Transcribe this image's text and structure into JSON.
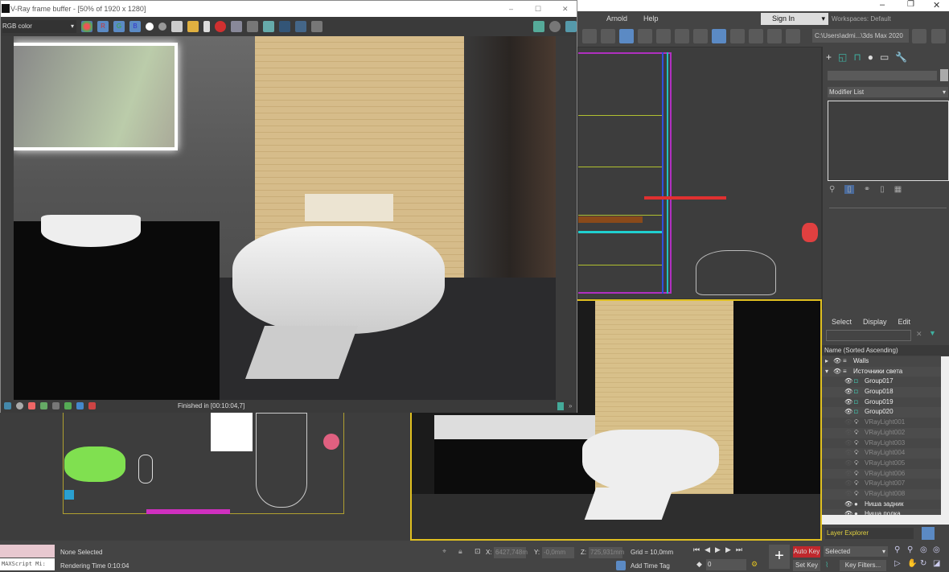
{
  "max": {
    "menu": [
      "Arnold",
      "Help"
    ],
    "sign_in": "Sign In",
    "workspaces_label": "Workspaces:",
    "workspace": "Default",
    "project_path": "C:\\Users\\admi...\\3ds Max 2020"
  },
  "vfb": {
    "title": "V-Ray frame buffer - [50% of 1920 x 1280]",
    "channel": "RGB color",
    "channel_buttons": [
      "R",
      "G",
      "B"
    ],
    "status": "Finished in [00:10:04,7]"
  },
  "command_panel": {
    "modifier_list": "Modifier List"
  },
  "scene_explorer": {
    "menu": [
      "Select",
      "Display",
      "Edit"
    ],
    "search_value": "",
    "column_header": "Name (Sorted Ascending)",
    "rows": [
      {
        "name": "Walls",
        "level": 0,
        "expand": "collapsed",
        "visible": true
      },
      {
        "name": "Источники света",
        "level": 0,
        "expand": "expanded",
        "visible": true
      },
      {
        "name": "Group017",
        "level": 1,
        "visible": true,
        "icon": "group"
      },
      {
        "name": "Group018",
        "level": 1,
        "visible": true,
        "icon": "group"
      },
      {
        "name": "Group019",
        "level": 1,
        "visible": true,
        "icon": "group"
      },
      {
        "name": "Group020",
        "level": 1,
        "visible": true,
        "icon": "group"
      },
      {
        "name": "VRayLight001",
        "level": 1,
        "visible": false,
        "icon": "light"
      },
      {
        "name": "VRayLight002",
        "level": 1,
        "visible": false,
        "icon": "light"
      },
      {
        "name": "VRayLight003",
        "level": 1,
        "visible": false,
        "icon": "light"
      },
      {
        "name": "VRayLight004",
        "level": 1,
        "visible": false,
        "icon": "light"
      },
      {
        "name": "VRayLight005",
        "level": 1,
        "visible": false,
        "icon": "light"
      },
      {
        "name": "VRayLight006",
        "level": 1,
        "visible": false,
        "icon": "light"
      },
      {
        "name": "VRayLight007",
        "level": 1,
        "visible": false,
        "icon": "light"
      },
      {
        "name": "VRayLight008",
        "level": 1,
        "visible": false,
        "icon": "light"
      },
      {
        "name": "Ниша задник",
        "level": 1,
        "visible": true,
        "icon": "object"
      },
      {
        "name": "Ниша полка",
        "level": 1,
        "visible": true,
        "icon": "object"
      }
    ],
    "footer_mode": "Layer Explorer"
  },
  "status": {
    "maxscript": "MAXScript Mi:",
    "selection": "None Selected",
    "rendering_time": "Rendering Time  0:10:04",
    "x_label": "X:",
    "x": "6427,748m",
    "y_label": "Y:",
    "y": "-0,0mm",
    "z_label": "Z:",
    "z": "725,931mm",
    "grid": "Grid = 10,0mm",
    "add_time_tag": "Add Time Tag",
    "frame": "0",
    "auto_key": "Auto Key",
    "set_key": "Set Key",
    "selected": "Selected",
    "key_filters": "Key Filters..."
  },
  "colors": {
    "accent": "#5b8ac4",
    "auto_key": "#c0282d",
    "frame_highlight": "#e0c020"
  }
}
